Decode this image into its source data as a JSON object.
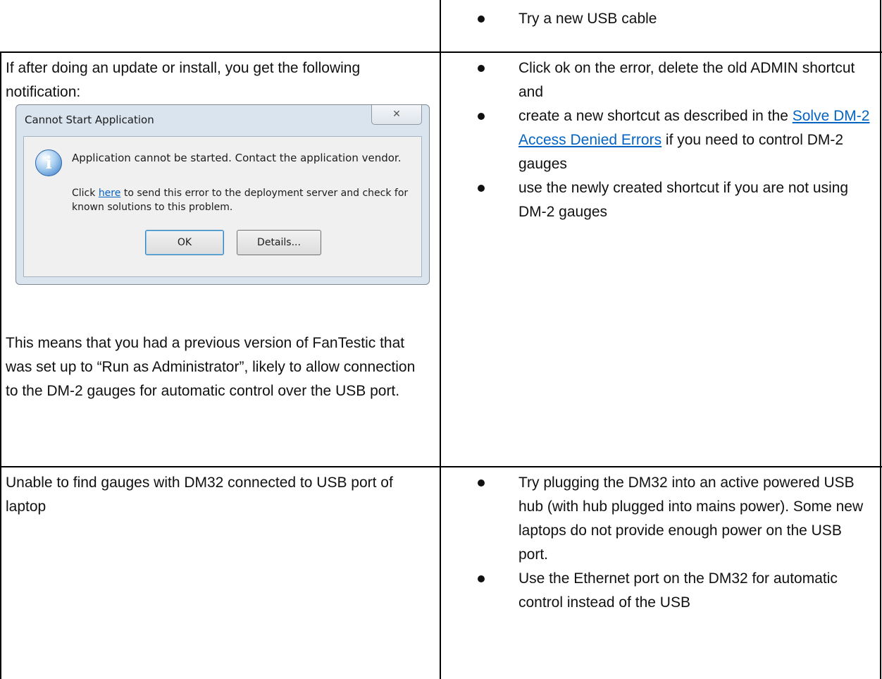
{
  "rows": [
    {
      "right_bullets": [
        "Try a new USB cable"
      ]
    },
    {
      "left_intro": "If after doing an update or install, you get the following notification:",
      "dialog": {
        "title": "Cannot Start Application",
        "close_glyph": "✕",
        "icon_glyph": "i",
        "message": "Application cannot be started. Contact the application vendor.",
        "link_prefix": "Click ",
        "link_text": "here",
        "link_suffix": " to send this error to the deployment server and check for known solutions to this problem.",
        "ok_label": "OK",
        "details_label": "Details..."
      },
      "left_explanation": "This means that you had a previous version of FanTestic that was set up to “Run as Administrator”, likely to allow connection to the DM-2 gauges for automatic control over the USB port.",
      "right_bullets": [
        "Click ok on the error, delete the old ADMIN shortcut and",
        "create a new shortcut as described in the",
        "use the newly created shortcut if you are not using DM-2 gauges"
      ],
      "right_link_text": "Solve DM-2 Access Denied Errors",
      "right_link_suffix": "  if you need to control DM-2 gauges"
    },
    {
      "left_text": "Unable to find gauges with DM32 connected to USB port of laptop",
      "right_bullets": [
        "Try plugging the DM32 into an active powered USB hub (with hub plugged into mains power).  Some new laptops do not provide enough power on the USB port.",
        "Use the Ethernet port on the DM32 for automatic control instead of the USB"
      ]
    }
  ],
  "colors": {
    "link": "#0563c1",
    "grid": "#000000"
  }
}
